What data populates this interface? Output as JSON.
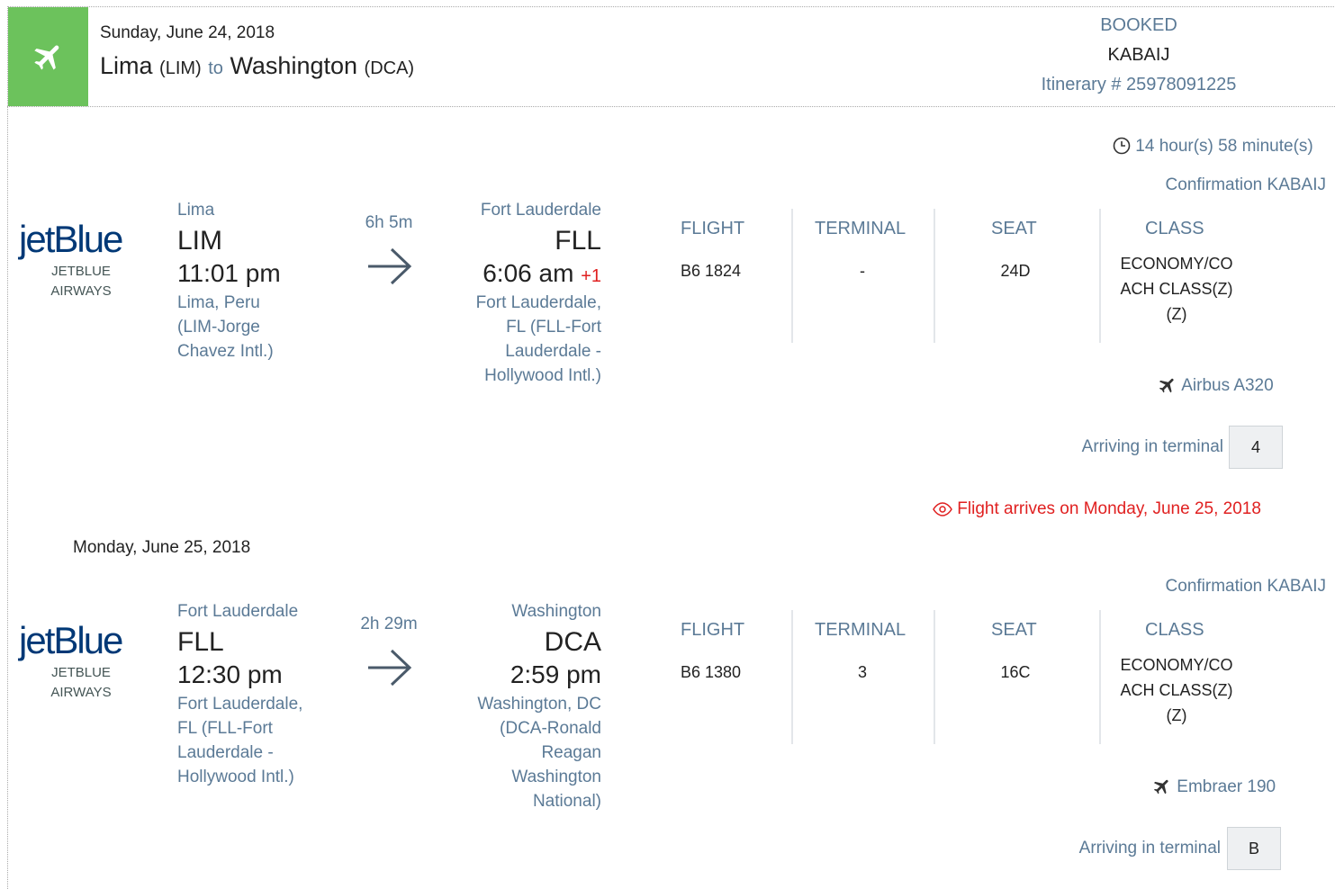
{
  "header": {
    "date": "Sunday, June 24, 2018",
    "origin_city": "Lima",
    "origin_code": "(LIM)",
    "to_word": "to",
    "dest_city": "Washington",
    "dest_code": "(DCA)",
    "status": "BOOKED",
    "record_locator": "KABAIJ",
    "itinerary": "Itinerary # 25978091225",
    "accent_color": "#6cc25c"
  },
  "trip": {
    "total_duration": "14 hour(s) 58 minute(s)"
  },
  "column_headers": {
    "flight": "FLIGHT",
    "terminal": "TERMINAL",
    "seat": "SEAT",
    "class": "CLASS"
  },
  "segments": [
    {
      "confirmation": "Confirmation KABAIJ",
      "airline_logo": "jetBlue",
      "airline_name_1": "JETBLUE",
      "airline_name_2": "AIRWAYS",
      "dep_city": "Lima",
      "dep_code": "LIM",
      "dep_time": "11:01 pm",
      "dep_airport": [
        "Lima, Peru",
        "(LIM-Jorge",
        "Chavez Intl.)"
      ],
      "duration": "6h 5m",
      "arr_city": "Fort Lauderdale",
      "arr_code": "FLL",
      "arr_time": "6:06 am",
      "arr_day_offset": "+1",
      "arr_airport": [
        "Fort Lauderdale,",
        "FL (FLL-Fort",
        "Lauderdale -",
        "Hollywood Intl.)"
      ],
      "flight_no": "B6 1824",
      "terminal": "-",
      "seat": "24D",
      "class_lines": [
        "ECONOMY/CO",
        "ACH CLASS(Z)",
        "(Z)"
      ],
      "aircraft": "Airbus A320",
      "arriving_label": "Arriving in terminal",
      "arriving_terminal": "4",
      "arrival_notice": "Flight arrives on Monday, June 25, 2018"
    },
    {
      "date": "Monday, June 25, 2018",
      "confirmation": "Confirmation KABAIJ",
      "airline_logo": "jetBlue",
      "airline_name_1": "JETBLUE",
      "airline_name_2": "AIRWAYS",
      "dep_city": "Fort Lauderdale",
      "dep_code": "FLL",
      "dep_time": "12:30 pm",
      "dep_airport": [
        "Fort Lauderdale,",
        "FL (FLL-Fort",
        "Lauderdale -",
        "Hollywood Intl.)"
      ],
      "duration": "2h 29m",
      "arr_city": "Washington",
      "arr_code": "DCA",
      "arr_time": "2:59 pm",
      "arr_airport": [
        "Washington, DC",
        "(DCA-Ronald",
        "Reagan",
        "Washington",
        "National)"
      ],
      "flight_no": "B6 1380",
      "terminal": "3",
      "seat": "16C",
      "class_lines": [
        "ECONOMY/CO",
        "ACH CLASS(Z)",
        "(Z)"
      ],
      "aircraft": "Embraer 190",
      "arriving_label": "Arriving in terminal",
      "arriving_terminal": "B"
    }
  ]
}
